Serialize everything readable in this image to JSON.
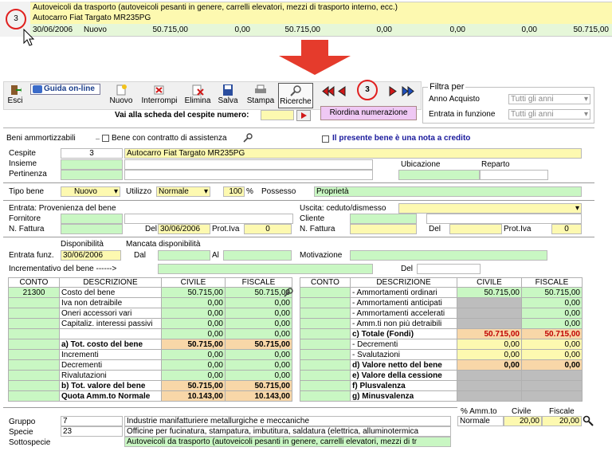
{
  "top_strip": {
    "row1_text": "Autoveicoli da trasporto (autoveicoli pesanti in genere, carrelli elevatori, mezzi di trasporto interno, ecc.)",
    "row2_num": "3",
    "row2_text": "Autocarro Fiat Targato MR235PG",
    "row3": [
      "30/06/2006",
      "Nuovo",
      "50.715,00",
      "0,00",
      "50.715,00",
      "0,00",
      "0,00",
      "0,00",
      "50.715,00"
    ]
  },
  "toolbar": {
    "esci": "Esci",
    "guida": "Guida on-line",
    "nuovo": "Nuovo",
    "interrompi": "Interrompi",
    "elimina": "Elimina",
    "salva": "Salva",
    "stampa": "Stampa",
    "ricerche": "Ricerche",
    "record_num": "3",
    "vai_label": "Vai alla scheda del cespite numero:",
    "riordina": "Riordina numerazione"
  },
  "filtra": {
    "title": "Filtra per",
    "anno_label": "Anno Acquisto",
    "anno_value": "Tutti gli anni",
    "entrata_label": "Entrata in funzione",
    "entrata_value": "Tutti gli anni"
  },
  "beni": {
    "section": "Beni ammortizzabili",
    "contratto": "Bene con contratto di assistenza",
    "nota": "Il presente bene è una nota a credito"
  },
  "cespite": {
    "cespite_label": "Cespite",
    "cespite_num": "3",
    "cespite_desc": "Autocarro Fiat Targato MR235PG",
    "insieme_label": "Insieme",
    "pertinenza_label": "Pertinenza",
    "ubicazione_label": "Ubicazione",
    "reparto_label": "Reparto",
    "tipo_label": "Tipo bene",
    "tipo_value": "Nuovo",
    "utilizzo_label": "Utilizzo",
    "utilizzo_value": "Normale",
    "perc_value": "100",
    "perc_sign": "%",
    "possesso_label": "Possesso",
    "possesso_value": "Proprietà"
  },
  "entrata": {
    "title": "Entrata: Provenienza del bene",
    "fornitore_label": "Fornitore",
    "fattura_label": "N. Fattura",
    "del_label": "Del",
    "del_value": "30/06/2006",
    "prot_label": "Prot.Iva",
    "prot_value": "0"
  },
  "uscita": {
    "title": "Uscita: ceduto/dismesso",
    "cliente_label": "Cliente",
    "fattura_label": "N. Fattura",
    "del_label": "Del",
    "prot_label": "Prot.Iva",
    "prot_value": "0"
  },
  "funz": {
    "disponibilita": "Disponibilità",
    "mancata": "Mancata disponibilità",
    "entrata_label": "Entrata funz.",
    "entrata_value": "30/06/2006",
    "dal_label": "Dal",
    "al_label": "Al",
    "motivazione_label": "Motivazione",
    "incrementativo_label": "Incrementativo del bene ------>",
    "del_label": "Del"
  },
  "left_table": {
    "headers": [
      "CONTO",
      "DESCRIZIONE",
      "CIVILE",
      "FISCALE"
    ],
    "rows": [
      {
        "conto": "21300",
        "desc": "Costo del bene",
        "civile": "50.715,00",
        "fiscale": "50.715,00"
      },
      {
        "conto": "",
        "desc": "Iva non detraibile",
        "civile": "0,00",
        "fiscale": "0,00"
      },
      {
        "conto": "",
        "desc": "Oneri accessori vari",
        "civile": "0,00",
        "fiscale": "0,00"
      },
      {
        "conto": "",
        "desc": "Capitaliz. interessi passivi",
        "civile": "0,00",
        "fiscale": "0,00"
      },
      {
        "conto": "",
        "desc": "",
        "civile": "0,00",
        "fiscale": "0,00"
      },
      {
        "conto": "",
        "desc": "a) Tot. costo del bene",
        "civile": "50.715,00",
        "fiscale": "50.715,00"
      },
      {
        "conto": "",
        "desc": "Incrementi",
        "civile": "0,00",
        "fiscale": "0,00"
      },
      {
        "conto": "",
        "desc": "Decrementi",
        "civile": "0,00",
        "fiscale": "0,00"
      },
      {
        "conto": "",
        "desc": "Rivalutazioni",
        "civile": "0,00",
        "fiscale": "0,00"
      },
      {
        "conto": "",
        "desc": "b) Tot. valore del bene",
        "civile": "50.715,00",
        "fiscale": "50.715,00"
      },
      {
        "conto": "",
        "desc": "Quota Amm.to Normale",
        "civile": "10.143,00",
        "fiscale": "10.143,00"
      }
    ]
  },
  "right_table": {
    "headers": [
      "CONTO",
      "DESCRIZIONE",
      "CIVILE",
      "FISCALE"
    ],
    "rows": [
      {
        "desc": "- Ammortamenti ordinari",
        "civile": "50.715,00",
        "fiscale": "50.715,00"
      },
      {
        "desc": "- Ammortamenti anticipati",
        "civile": "",
        "fiscale": "0,00"
      },
      {
        "desc": "- Ammortamenti accelerati",
        "civile": "",
        "fiscale": "0,00"
      },
      {
        "desc": "- Amm.ti non più detraibili",
        "civile": "",
        "fiscale": "0,00"
      },
      {
        "desc": "c) Totale (Fondi)",
        "civile": "50.715,00",
        "fiscale": "50.715,00"
      },
      {
        "desc": "- Decrementi",
        "civile": "0,00",
        "fiscale": "0,00"
      },
      {
        "desc": "- Svalutazioni",
        "civile": "0,00",
        "fiscale": "0,00"
      },
      {
        "desc": "d) Valore netto del bene",
        "civile": "0,00",
        "fiscale": "0,00"
      },
      {
        "desc": "e) Valore della cessione",
        "civile": "",
        "fiscale": ""
      },
      {
        "desc": "f) Plusvalenza",
        "civile": "",
        "fiscale": ""
      },
      {
        "desc": "g) Minusvalenza",
        "civile": "",
        "fiscale": ""
      }
    ]
  },
  "bottom": {
    "gruppo_label": "Gruppo",
    "gruppo_num": "7",
    "gruppo_desc": "Industrie manifatturiere metallurgiche e meccaniche",
    "specie_label": "Specie",
    "specie_num": "23",
    "specie_desc": "Officine per fucinatura, stampatura, imbutitura, saldatura (elettrica, alluminotermica",
    "sottospecie_label": "Sottospecie",
    "sottospecie_desc": "Autoveicoli da trasporto (autoveicoli pesanti in genere, carrelli elevatori, mezzi di tr",
    "amm_label": "% Amm.to",
    "civile_label": "Civile",
    "fiscale_label": "Fiscale",
    "amm_type": "Normale",
    "amm_civile": "20,00",
    "amm_fiscale": "20,00"
  }
}
